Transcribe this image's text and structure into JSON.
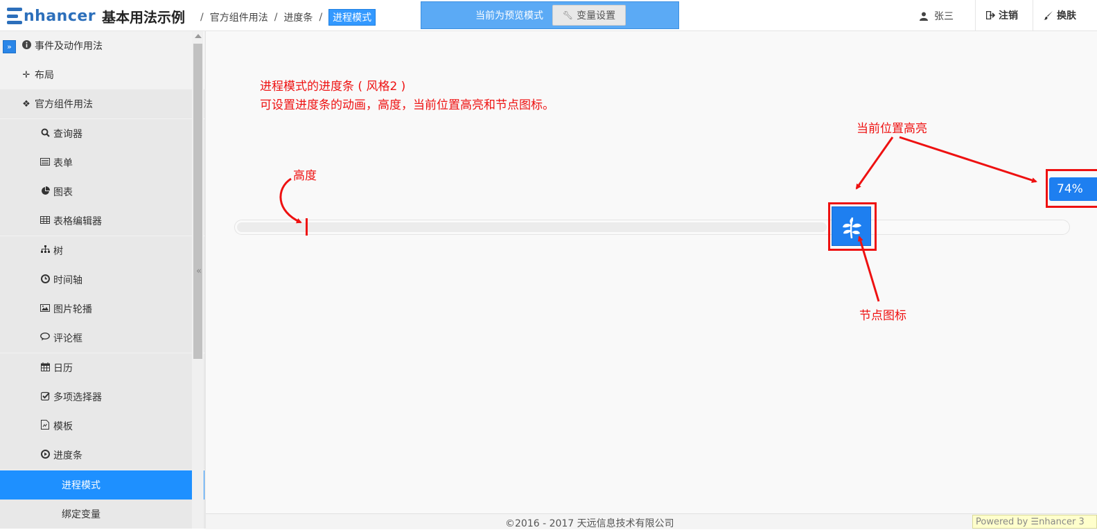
{
  "header": {
    "logo_text": "nhancer",
    "page_title": "基本用法示例",
    "breadcrumb": [
      "官方组件用法",
      "进度条",
      "进程模式"
    ],
    "preview_text": "当前为预览模式",
    "var_settings_label": "变量设置",
    "user_name": "张三",
    "logout_label": "注销",
    "skin_label": "换肤"
  },
  "sidebar": {
    "items": [
      {
        "label": "事件及动作用法",
        "icon": "info-icon"
      },
      {
        "label": "布局",
        "icon": "move-icon"
      },
      {
        "label": "官方组件用法",
        "icon": "puzzle-icon"
      },
      {
        "label": "查询器",
        "icon": "search-icon"
      },
      {
        "label": "表单",
        "icon": "list-icon"
      },
      {
        "label": "图表",
        "icon": "pie-chart-icon"
      },
      {
        "label": "表格编辑器",
        "icon": "table-icon"
      },
      {
        "label": "树",
        "icon": "sitemap-icon"
      },
      {
        "label": "时间轴",
        "icon": "clock-icon"
      },
      {
        "label": "图片轮播",
        "icon": "image-icon"
      },
      {
        "label": "评论框",
        "icon": "comment-icon"
      },
      {
        "label": "日历",
        "icon": "calendar-icon"
      },
      {
        "label": "多项选择器",
        "icon": "checkbox-icon"
      },
      {
        "label": "模板",
        "icon": "template-icon"
      },
      {
        "label": "进度条",
        "icon": "play-circle-icon"
      },
      {
        "label": "进程模式",
        "icon": ""
      },
      {
        "label": "绑定变量",
        "icon": ""
      }
    ]
  },
  "main": {
    "desc_line1": "进程模式的进度条 ( 风格2 )",
    "desc_line2": "可设置进度条的动画，高度，当前位置高亮和节点图标。",
    "label_height": "高度",
    "label_highlight": "当前位置高亮",
    "label_node_icon": "节点图标",
    "progress_percent_text": "74%",
    "progress_value": 0.74,
    "node_icon": "leaf-icon",
    "accent_color": "#1e7ff0",
    "annotation_color": "#ee1111"
  },
  "footer": {
    "copyright": "©2016 - 2017 天远信息技术有限公司",
    "powered": "Powered by ☰nhancer 3"
  }
}
